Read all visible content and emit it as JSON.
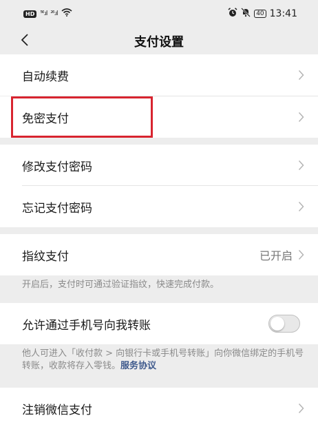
{
  "status_bar": {
    "hd_badge": "HD",
    "signal_1": "⁵⁶.ıl",
    "signal_2": "²⁶.ıl",
    "battery": "40",
    "time": "13:41"
  },
  "nav": {
    "title": "支付设置"
  },
  "rows": {
    "auto_renew": "自动续费",
    "password_free": "免密支付",
    "change_password": "修改支付密码",
    "forgot_password": "忘记支付密码",
    "fingerprint": {
      "label": "指纹支付",
      "status": "已开启"
    },
    "phone_transfer": {
      "label": "允许通过手机号向我转账",
      "enabled": false
    },
    "cancel_wechat_pay": "注销微信支付"
  },
  "hints": {
    "fingerprint": "开启后，支付时可通过验证指纹，快速完成付款。",
    "phone_transfer": "他人可进入「收付款 > 向银行卡或手机号转账」向你微信绑定的手机号转账，收款将存入零钱。",
    "phone_transfer_link": "服务协议"
  },
  "colors": {
    "highlight": "#d8242f",
    "link": "#3f5a8d",
    "background": "#ededed"
  }
}
